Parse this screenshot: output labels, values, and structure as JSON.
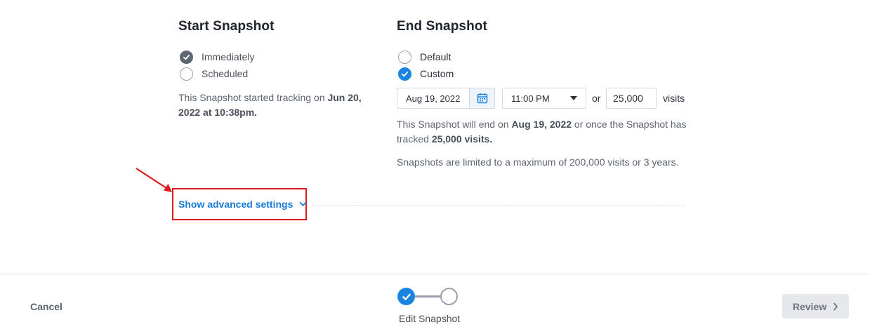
{
  "start": {
    "title": "Start Snapshot",
    "options": [
      "Immediately",
      "Scheduled"
    ],
    "selected": "Immediately",
    "info_prefix": "This Snapshot started tracking on ",
    "info_bold": "Jun 20, 2022 at 10:38pm."
  },
  "end": {
    "title": "End Snapshot",
    "options": [
      "Default",
      "Custom"
    ],
    "selected": "Custom",
    "date_value": "Aug 19, 2022",
    "time_value": "11:00 PM",
    "or_label": "or",
    "visits_value": "25,000",
    "visits_label": "visits",
    "info_part1": "This Snapshot will end on ",
    "info_bold1": "Aug 19, 2022",
    "info_part2": " or once the Snapshot has tracked ",
    "info_bold2": "25,000 visits.",
    "limit_text": "Snapshots are limited to a maximum of 200,000 visits or 3 years."
  },
  "advanced": {
    "link_label": "Show advanced settings"
  },
  "footer": {
    "cancel_label": "Cancel",
    "step_label": "Edit Snapshot",
    "review_label": "Review",
    "steps_completed": 1,
    "steps_total": 2
  },
  "colors": {
    "accent_blue": "#1a85e0",
    "link_blue": "#1a7bd6",
    "annotation_red": "#e01b1b"
  }
}
